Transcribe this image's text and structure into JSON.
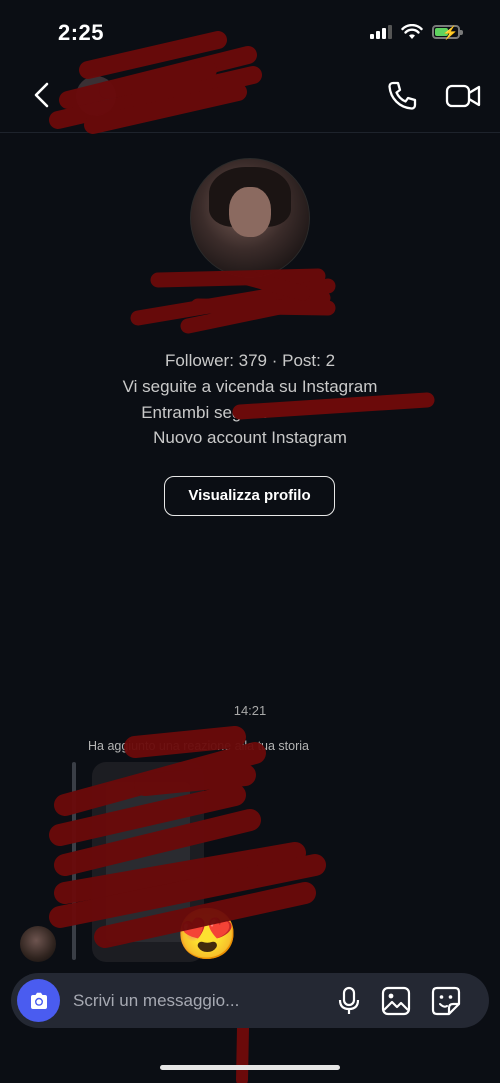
{
  "status_bar": {
    "time": "2:25"
  },
  "header": {
    "username": ""
  },
  "profile": {
    "name": "",
    "handle": "",
    "stats": "Follower: 379 · Post: 2",
    "mutual_follow": "Vi seguite a vicenda su Instagram",
    "followed_by": "Entrambi seguite",
    "new_account": "Nuovo account Instagram",
    "view_profile_label": "Visualizza profilo"
  },
  "conversation": {
    "timestamp": "14:21",
    "reaction_note": "Ha aggiunto una reazione alla tua storia",
    "reaction_emoji": "😍"
  },
  "composer": {
    "placeholder": "Scrivi un messaggio..."
  },
  "colors": {
    "background": "#0b0e14",
    "camera_button": "#4a5cf0",
    "redaction": "#6b0a0a"
  }
}
